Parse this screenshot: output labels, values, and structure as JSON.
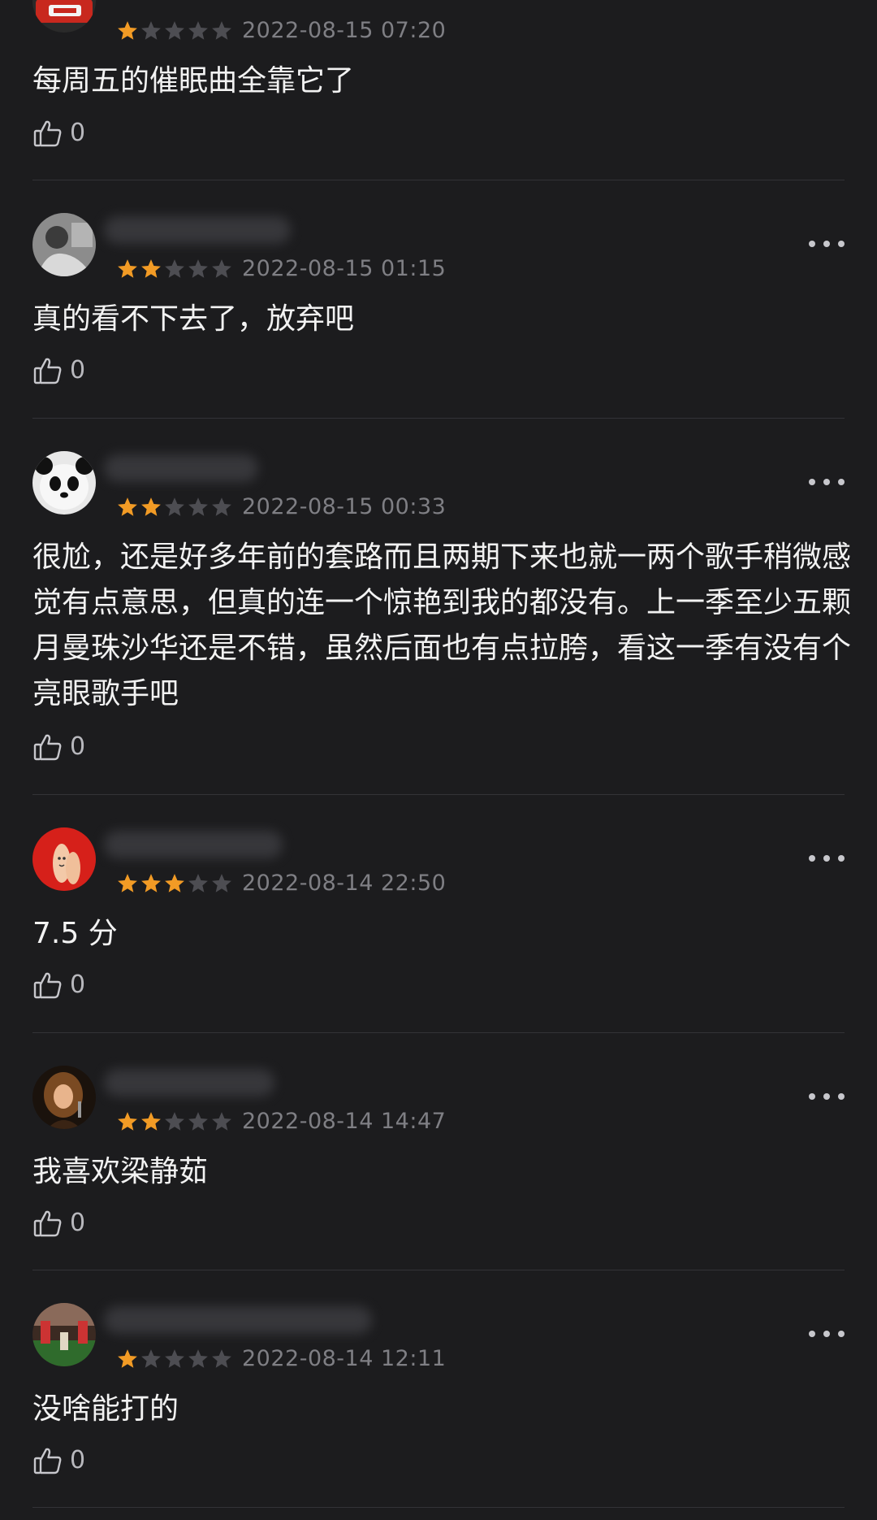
{
  "colors": {
    "background": "#1c1c1e",
    "star_filled": "#f29b25",
    "star_empty": "#4d4d52",
    "text": "#f2f2f2",
    "timestamp": "#7f7f84"
  },
  "comments": [
    {
      "rating": 1,
      "timestamp": "2022-08-15 07:20",
      "text": "每周五的催眠曲全靠它了",
      "likes": "0",
      "avatar": "avatar-red-logo"
    },
    {
      "rating": 2,
      "timestamp": "2022-08-15 01:15",
      "text": "真的看不下去了，放弃吧",
      "likes": "0",
      "avatar": "avatar-grey-photo"
    },
    {
      "rating": 2,
      "timestamp": "2022-08-15 00:33",
      "text": "很尬，还是好多年前的套路而且两期下来也就一两个歌手稍微感觉有点意思，但真的连一个惊艳到我的都没有。上一季至少五颗月曼珠沙华还是不错，虽然后面也有点拉胯，看这一季有没有个亮眼歌手吧",
      "likes": "0",
      "avatar": "avatar-panda"
    },
    {
      "rating": 3,
      "timestamp": "2022-08-14 22:50",
      "text": "7.5 分",
      "likes": "0",
      "avatar": "avatar-red-finger"
    },
    {
      "rating": 2,
      "timestamp": "2022-08-14 14:47",
      "text": "我喜欢梁静茹",
      "likes": "0",
      "avatar": "avatar-singer"
    },
    {
      "rating": 1,
      "timestamp": "2022-08-14 12:11",
      "text": "没啥能打的",
      "likes": "0",
      "avatar": "avatar-garden"
    }
  ]
}
